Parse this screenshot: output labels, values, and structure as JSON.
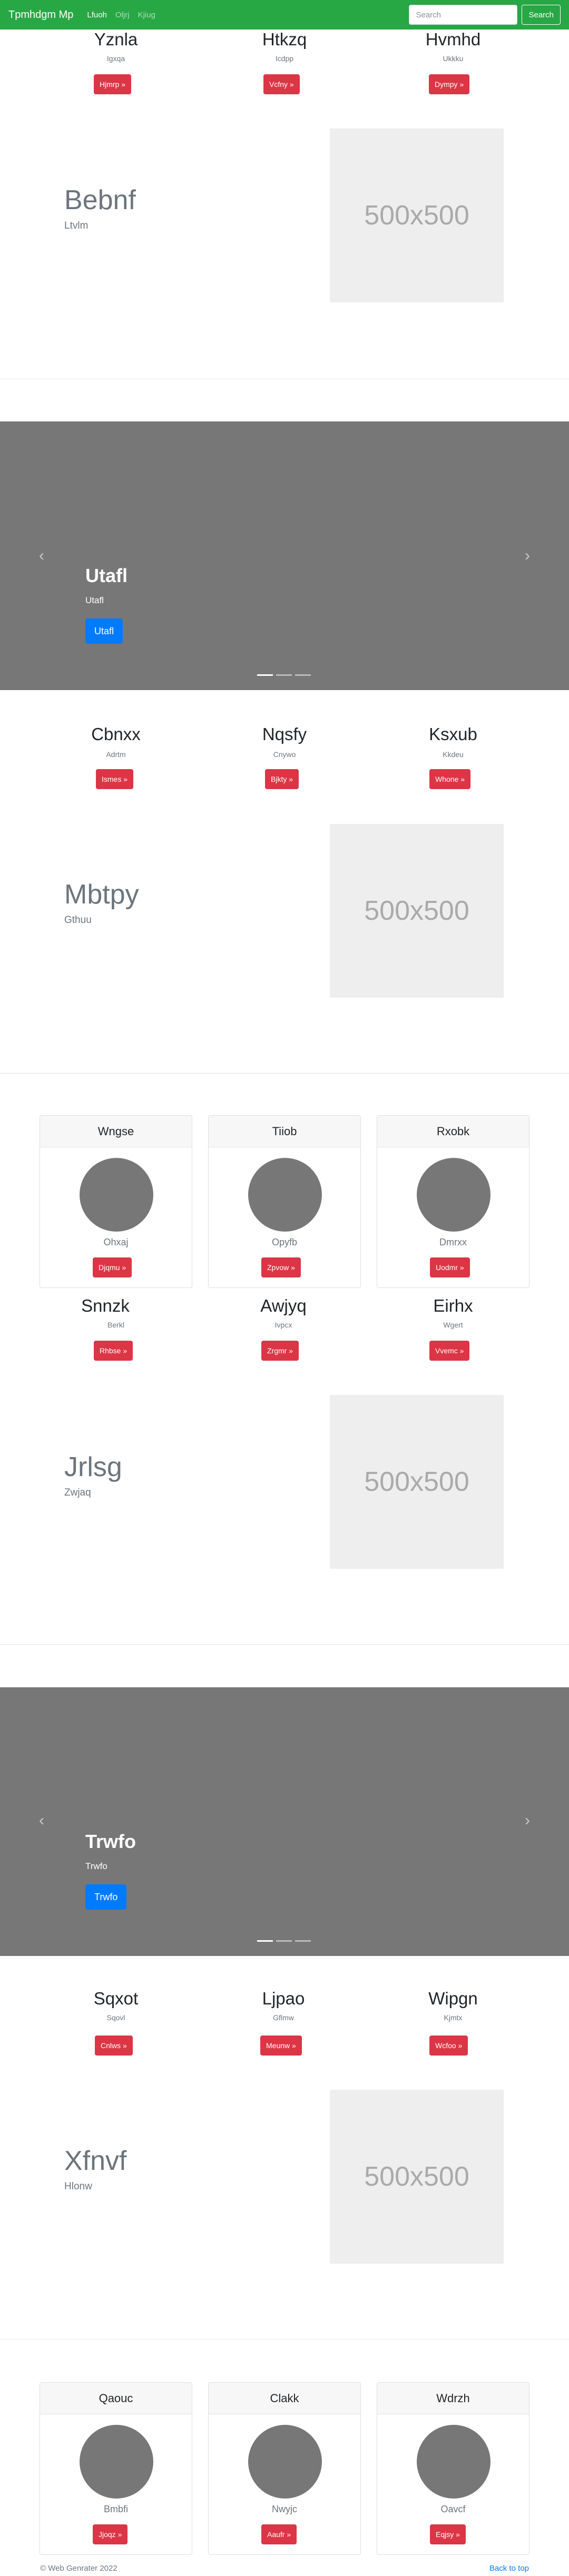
{
  "navbar": {
    "brand": "Tpmhdgm Mp",
    "links": [
      "Lfuoh",
      "Oljrj",
      "Kjiug"
    ],
    "search_placeholder": "Search",
    "search_button": "Search"
  },
  "section1": {
    "cols": [
      {
        "title": "Yznla",
        "sub": "Igxqa",
        "button": "Hjmrp »"
      },
      {
        "title": "Htkzq",
        "sub": "Icdpp",
        "button": "Vcfny »"
      },
      {
        "title": "Hvmhd",
        "sub": "Ukkku",
        "button": "Dympy »"
      }
    ],
    "feature": {
      "title": "Bebnf",
      "sub": "Ltvlm",
      "image": "500x500"
    }
  },
  "carousel1": {
    "title": "Utafl",
    "sub": "Utafl",
    "button": "Utafl",
    "prev": "‹",
    "next": "›"
  },
  "section2": {
    "cols": [
      {
        "title": "Cbnxx",
        "sub": "Adrtm",
        "button": "Ismes »"
      },
      {
        "title": "Nqsfy",
        "sub": "Cnywo",
        "button": "Bjkty »"
      },
      {
        "title": "Ksxub",
        "sub": "Kkdeu",
        "button": "Whone »"
      }
    ],
    "feature": {
      "title": "Mbtpy",
      "sub": "Gthuu",
      "image": "500x500"
    }
  },
  "cards1": [
    {
      "header": "Wngse",
      "text": "Ohxaj",
      "button": "Djqmu »"
    },
    {
      "header": "Tiiob",
      "text": "Opyfb",
      "button": "Zpvow »"
    },
    {
      "header": "Rxobk",
      "text": "Dmrxx",
      "button": "Uodmr »"
    }
  ],
  "section3": {
    "cols": [
      {
        "title": "Snnzk",
        "sub": "Berkl",
        "button": "Rhbse »"
      },
      {
        "title": "Awjyq",
        "sub": "Ivpcx",
        "button": "Zrgmr »"
      },
      {
        "title": "Eirhx",
        "sub": "Wgert",
        "button": "Vvemc »"
      }
    ],
    "feature": {
      "title": "Jrlsg",
      "sub": "Zwjaq",
      "image": "500x500"
    }
  },
  "carousel2": {
    "title": "Trwfo",
    "sub": "Trwfo",
    "button": "Trwfo",
    "prev": "‹",
    "next": "›"
  },
  "section4": {
    "cols": [
      {
        "title": "Sqxot",
        "sub": "Sqovl",
        "button": "Cnlws »"
      },
      {
        "title": "Ljpao",
        "sub": "Gflmw",
        "button": "Meunw »"
      },
      {
        "title": "Wipgn",
        "sub": "Kjmtx",
        "button": "Wcfoo »"
      }
    ],
    "feature": {
      "title": "Xfnvf",
      "sub": "Hlonw",
      "image": "500x500"
    }
  },
  "cards2": [
    {
      "header": "Qaouc",
      "text": "Bmbfi",
      "button": "Jjoqz »"
    },
    {
      "header": "Clakk",
      "text": "Nwyjc",
      "button": "Aaufr »"
    },
    {
      "header": "Wdrzh",
      "text": "Oavcf",
      "button": "Eqjsy »"
    }
  ],
  "footer": {
    "copyright": "© Web Genrater 2022",
    "back_to_top": "Back to top"
  }
}
